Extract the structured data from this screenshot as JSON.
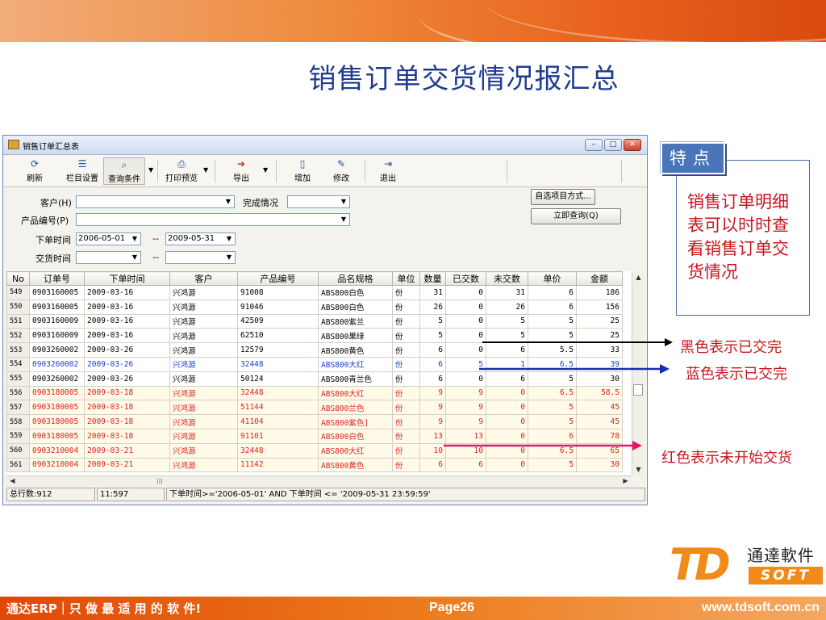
{
  "slide": {
    "title": "销售订单交货情况报汇总",
    "page_label": "Page26",
    "footer_brand": "通达ERP｜只 做 最 适 用 的 软 件!",
    "footer_url": "www.tdsoft.com.cn",
    "logo_cn": "通達軟件",
    "logo_td": "TD",
    "logo_soft": "SOFT"
  },
  "window": {
    "title": "销售订单汇总表",
    "buttons": {
      "minimize": "–",
      "maximize": "□",
      "close": "✕"
    }
  },
  "toolbar": {
    "refresh": "刷新",
    "columns": "栏目设置",
    "query_conditions": "查询条件",
    "print_preview": "打印预览",
    "export": "导出",
    "add": "增加",
    "edit": "修改",
    "exit": "退出"
  },
  "filters": {
    "customer_label": "客户(H)",
    "completion_label": "完成情况",
    "product_label": "产品编号(P)",
    "order_time_label": "下单时间",
    "order_time_from": "2006-05-01",
    "order_time_to": "2009-05-31",
    "range_sep": "--",
    "delivery_time_label": "交货时间",
    "custom_mode_button": "自选项目方式...",
    "query_now_button": "立即查询(Q)"
  },
  "grid": {
    "columns": [
      "No",
      "订单号",
      "下单时间",
      "客户",
      "产品编号",
      "品名规格",
      "单位",
      "数量",
      "已交数",
      "未交数",
      "单价",
      "金额"
    ],
    "rows": [
      {
        "status": "black",
        "cells": [
          "549",
          "0903160005",
          "2009-03-16",
          "兴鸿源",
          "91008",
          "ABS800白色",
          "份",
          "31",
          "0",
          "31",
          "6",
          "186"
        ]
      },
      {
        "status": "black",
        "cells": [
          "550",
          "0903160005",
          "2009-03-16",
          "兴鸿源",
          "91046",
          "ABS800白色",
          "份",
          "26",
          "0",
          "26",
          "6",
          "156"
        ]
      },
      {
        "status": "black",
        "cells": [
          "551",
          "0903160009",
          "2009-03-16",
          "兴鸿源",
          "42509",
          "ABS800紫兰",
          "份",
          "5",
          "0",
          "5",
          "5",
          "25"
        ]
      },
      {
        "status": "black",
        "cells": [
          "552",
          "0903160009",
          "2009-03-16",
          "兴鸿源",
          "62510",
          "ABS800果绿",
          "份",
          "5",
          "0",
          "5",
          "5",
          "25"
        ]
      },
      {
        "status": "black",
        "cells": [
          "553",
          "0903260002",
          "2009-03-26",
          "兴鸿源",
          "12579",
          "ABS800黄色",
          "份",
          "6",
          "0",
          "6",
          "5.5",
          "33"
        ]
      },
      {
        "status": "blue",
        "cells": [
          "554",
          "0903260002",
          "2009-03-26",
          "兴鸿源",
          "32448",
          "ABS800大红",
          "份",
          "6",
          "5",
          "1",
          "6.5",
          "39"
        ]
      },
      {
        "status": "black",
        "cells": [
          "555",
          "0903260002",
          "2009-03-26",
          "兴鸿源",
          "50124",
          "ABS800青兰色",
          "份",
          "6",
          "0",
          "6",
          "5",
          "30"
        ]
      },
      {
        "status": "red",
        "cells": [
          "556",
          "0903180005",
          "2009-03-18",
          "兴鸿源",
          "32448",
          "ABS800大红",
          "份",
          "9",
          "9",
          "0",
          "6.5",
          "58.5"
        ]
      },
      {
        "status": "red",
        "cells": [
          "557",
          "0903180005",
          "2009-03-18",
          "兴鸿源",
          "51144",
          "ABS800兰色",
          "份",
          "9",
          "9",
          "0",
          "5",
          "45"
        ]
      },
      {
        "status": "red",
        "cells": [
          "558",
          "0903180005",
          "2009-03-18",
          "兴鸿源",
          "41104",
          "ABS800紫色]",
          "份",
          "9",
          "9",
          "0",
          "5",
          "45"
        ]
      },
      {
        "status": "red",
        "cells": [
          "559",
          "0903180005",
          "2009-03-18",
          "兴鸿源",
          "91101",
          "ABS800白色",
          "份",
          "13",
          "13",
          "0",
          "6",
          "78"
        ]
      },
      {
        "status": "red",
        "cells": [
          "560",
          "0903210004",
          "2009-03-21",
          "兴鸿源",
          "32448",
          "ABS800大红",
          "份",
          "10",
          "10",
          "0",
          "6.5",
          "65"
        ]
      },
      {
        "status": "red",
        "cells": [
          "561",
          "0903210004",
          "2009-03-21",
          "兴鸿源",
          "11142",
          "ABS800黄色",
          "份",
          "6",
          "6",
          "0",
          "5",
          "30"
        ]
      }
    ]
  },
  "status_bar": {
    "total_rows": "总行数:912",
    "time": "11:597",
    "filter_expr": "下单时间>='2006-05-01' AND 下单时间 <= '2009-05-31 23:59:59'"
  },
  "feature": {
    "tag": "特点",
    "text": "销售订单明细表可以时时查看销售订单交货情况"
  },
  "legend": {
    "black": "黑色表示已交完",
    "blue": "蓝色表示已交完",
    "red": "红色表示未开始交货"
  },
  "colors": {
    "title_blue": "#1f3c8f",
    "annotation_red": "#c8161e",
    "row_blue": "#1a3fd0",
    "row_red": "#e02020",
    "brand_orange": "#f08a18"
  }
}
